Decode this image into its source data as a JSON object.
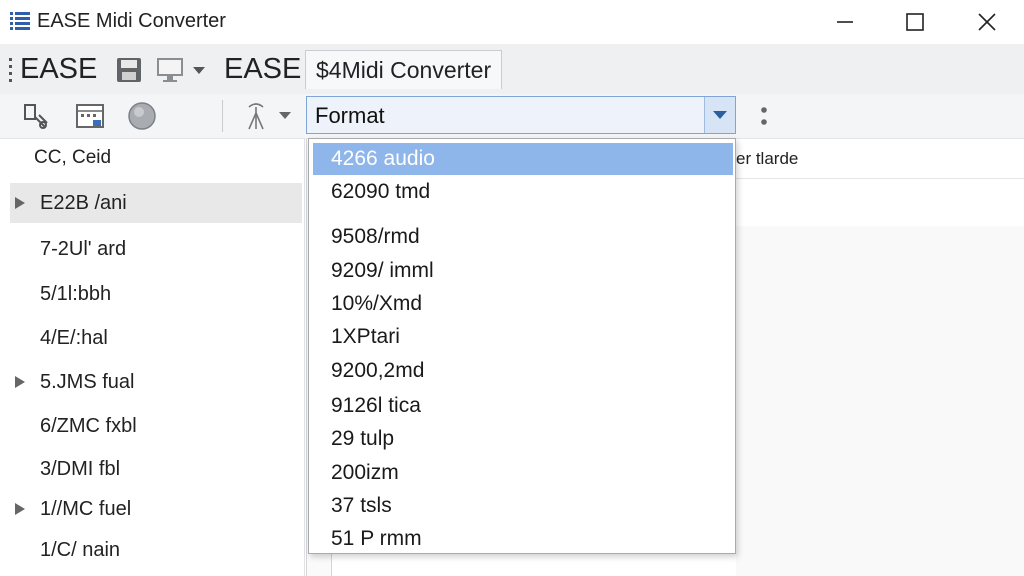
{
  "window": {
    "title": "EASE Midi Converter",
    "controls": [
      "minimize",
      "maximize",
      "close"
    ]
  },
  "ribbon": {
    "app_label": "EASE",
    "app_label_2": "EASE",
    "tab_label": "$4Midi Converter"
  },
  "toolbar": {
    "format_select": {
      "value": "Format"
    }
  },
  "sidebar": {
    "header": "CC, Ceid",
    "items": [
      {
        "label": "E22B /ani",
        "expandable": true,
        "selected": true
      },
      {
        "label": "7-2Ul' ard",
        "expandable": false
      },
      {
        "label": "5/1l:bbh",
        "expandable": false
      },
      {
        "label": "4/E/:hal",
        "expandable": false
      },
      {
        "label": "5.JMS fual",
        "expandable": true
      },
      {
        "label": "6/ZMC fxbl",
        "expandable": false
      },
      {
        "label": "3/DMI fbl",
        "expandable": false
      },
      {
        "label": "1//MC fuel",
        "expandable": true
      },
      {
        "label": "1/C/ nain",
        "expandable": false
      }
    ]
  },
  "content": {
    "header_fragment": "er tlarde"
  },
  "dropdown": {
    "highlighted_index": 0,
    "options": [
      "4266 audio",
      "62090 tmd",
      "9508/rmd",
      "9209/ imml",
      "10%/Xmd",
      "1XPtari",
      "9200,2md",
      "9126l tica",
      "29 tulp",
      "200izm",
      "37 tsls",
      "51 P rmm"
    ]
  },
  "colors": {
    "highlight": "#8fb6ea",
    "combo_border": "#7ea4d8",
    "combo_button": "#d6e4f6"
  }
}
